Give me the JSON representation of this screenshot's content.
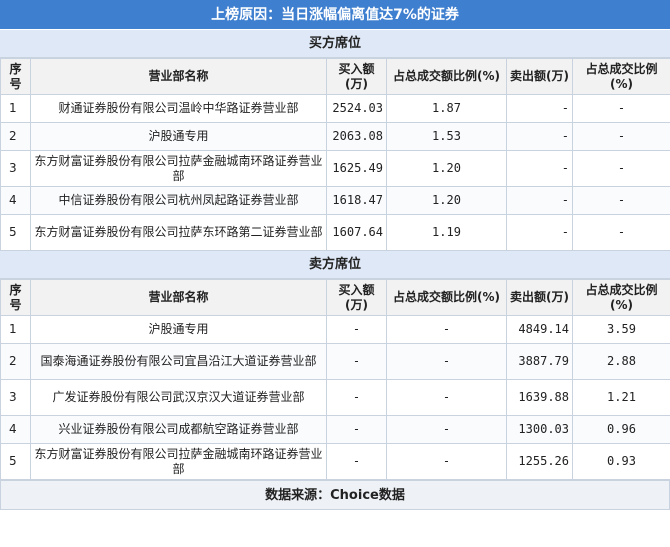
{
  "title": "上榜原因：当日涨幅偏离值达7%的证券",
  "buy_section": {
    "title": "买方席位",
    "headers": {
      "idx": "序号",
      "name": "营业部名称",
      "buy": "买入额(万)",
      "buy_pct": "占总成交额比例(%)",
      "sell": "卖出额(万)",
      "sell_pct": "占总成交比例(%)"
    },
    "rows": [
      {
        "idx": "1",
        "name": "财通证券股份有限公司温岭中华路证券营业部",
        "buy": "2524.03",
        "buy_pct": "1.87",
        "sell": "-",
        "sell_pct": "-"
      },
      {
        "idx": "2",
        "name": "沪股通专用",
        "buy": "2063.08",
        "buy_pct": "1.53",
        "sell": "-",
        "sell_pct": "-"
      },
      {
        "idx": "3",
        "name": "东方财富证券股份有限公司拉萨金融城南环路证券营业部",
        "buy": "1625.49",
        "buy_pct": "1.20",
        "sell": "-",
        "sell_pct": "-"
      },
      {
        "idx": "4",
        "name": "中信证券股份有限公司杭州凤起路证券营业部",
        "buy": "1618.47",
        "buy_pct": "1.20",
        "sell": "-",
        "sell_pct": "-"
      },
      {
        "idx": "5",
        "name": "东方财富证券股份有限公司拉萨东环路第二证券营业部",
        "buy": "1607.64",
        "buy_pct": "1.19",
        "sell": "-",
        "sell_pct": "-"
      }
    ]
  },
  "sell_section": {
    "title": "卖方席位",
    "headers": {
      "idx": "序号",
      "name": "营业部名称",
      "buy": "买入额(万)",
      "buy_pct": "占总成交额比例(%)",
      "sell": "卖出额(万)",
      "sell_pct": "占总成交比例(%)"
    },
    "rows": [
      {
        "idx": "1",
        "name": "沪股通专用",
        "buy": "-",
        "buy_pct": "-",
        "sell": "4849.14",
        "sell_pct": "3.59"
      },
      {
        "idx": "2",
        "name": "国泰海通证券股份有限公司宜昌沿江大道证券营业部",
        "buy": "-",
        "buy_pct": "-",
        "sell": "3887.79",
        "sell_pct": "2.88"
      },
      {
        "idx": "3",
        "name": "广发证券股份有限公司武汉京汉大道证券营业部",
        "buy": "-",
        "buy_pct": "-",
        "sell": "1639.88",
        "sell_pct": "1.21"
      },
      {
        "idx": "4",
        "name": "兴业证券股份有限公司成都航空路证券营业部",
        "buy": "-",
        "buy_pct": "-",
        "sell": "1300.03",
        "sell_pct": "0.96"
      },
      {
        "idx": "5",
        "name": "东方财富证券股份有限公司拉萨金融城南环路证券营业部",
        "buy": "-",
        "buy_pct": "-",
        "sell": "1255.26",
        "sell_pct": "0.93"
      }
    ]
  },
  "footer": "数据来源：Choice数据",
  "colors": {
    "title_bg": "#3f7fcf",
    "section_bg": "#dfe8f6",
    "header_bg": "#f2f2f2",
    "border": "#c9d3e0"
  }
}
